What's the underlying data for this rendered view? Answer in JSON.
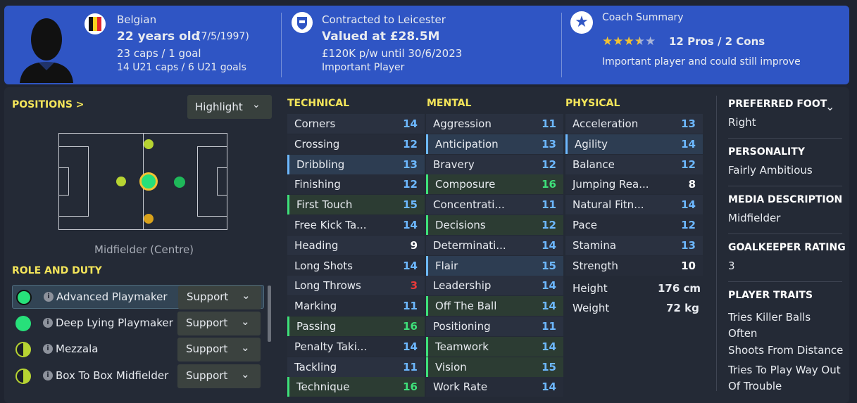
{
  "header": {
    "nationality": "Belgian",
    "age": "22 years old",
    "dob": "(7/5/1997)",
    "caps": "23 caps / 1 goal",
    "u21": "14 U21 caps / 6 U21 goals",
    "contract": "Contracted to Leicester",
    "value": "Valued at £28.5M",
    "wage": "£120K p/w until 30/6/2023",
    "status": "Important Player",
    "coach_title": "Coach Summary",
    "pros_cons": "12 Pros / 2 Cons",
    "coach_text": "Important player and could still improve",
    "star_rating": 3.5
  },
  "positions": {
    "title": "POSITIONS >",
    "highlight": "Highlight",
    "position_label": "Midfielder (Centre)"
  },
  "roles": {
    "title": "ROLE AND DUTY",
    "items": [
      {
        "name": "Advanced Playmaker",
        "duty": "Support"
      },
      {
        "name": "Deep Lying Playmaker",
        "duty": "Support"
      },
      {
        "name": "Mezzala",
        "duty": "Support"
      },
      {
        "name": "Box To Box Midfielder",
        "duty": "Support"
      }
    ]
  },
  "technical": {
    "title": "TECHNICAL",
    "items": [
      {
        "n": "Corners",
        "v": "14"
      },
      {
        "n": "Crossing",
        "v": "12"
      },
      {
        "n": "Dribbling",
        "v": "13"
      },
      {
        "n": "Finishing",
        "v": "12"
      },
      {
        "n": "First Touch",
        "v": "15"
      },
      {
        "n": "Free Kick Ta...",
        "v": "14"
      },
      {
        "n": "Heading",
        "v": "9"
      },
      {
        "n": "Long Shots",
        "v": "14"
      },
      {
        "n": "Long Throws",
        "v": "3"
      },
      {
        "n": "Marking",
        "v": "11"
      },
      {
        "n": "Passing",
        "v": "16"
      },
      {
        "n": "Penalty Taki...",
        "v": "14"
      },
      {
        "n": "Tackling",
        "v": "11"
      },
      {
        "n": "Technique",
        "v": "16"
      }
    ]
  },
  "mental": {
    "title": "MENTAL",
    "items": [
      {
        "n": "Aggression",
        "v": "11"
      },
      {
        "n": "Anticipation",
        "v": "13"
      },
      {
        "n": "Bravery",
        "v": "12"
      },
      {
        "n": "Composure",
        "v": "16"
      },
      {
        "n": "Concentrati...",
        "v": "11"
      },
      {
        "n": "Decisions",
        "v": "12"
      },
      {
        "n": "Determinati...",
        "v": "14"
      },
      {
        "n": "Flair",
        "v": "15"
      },
      {
        "n": "Leadership",
        "v": "14"
      },
      {
        "n": "Off The Ball",
        "v": "14"
      },
      {
        "n": "Positioning",
        "v": "11"
      },
      {
        "n": "Teamwork",
        "v": "14"
      },
      {
        "n": "Vision",
        "v": "15"
      },
      {
        "n": "Work Rate",
        "v": "14"
      }
    ]
  },
  "physical": {
    "title": "PHYSICAL",
    "items": [
      {
        "n": "Acceleration",
        "v": "13"
      },
      {
        "n": "Agility",
        "v": "14"
      },
      {
        "n": "Balance",
        "v": "12"
      },
      {
        "n": "Jumping Rea...",
        "v": "8"
      },
      {
        "n": "Natural Fitn...",
        "v": "14"
      },
      {
        "n": "Pace",
        "v": "12"
      },
      {
        "n": "Stamina",
        "v": "13"
      },
      {
        "n": "Strength",
        "v": "10"
      }
    ],
    "height_label": "Height",
    "height": "176 cm",
    "weight_label": "Weight",
    "weight": "72 kg"
  },
  "profile": {
    "foot_label": "PREFERRED FOOT",
    "foot": "Right",
    "personality_label": "PERSONALITY",
    "personality": "Fairly Ambitious",
    "media_label": "MEDIA DESCRIPTION",
    "media": "Midfielder",
    "gk_label": "GOALKEEPER RATING",
    "gk": "3",
    "traits_label": "PLAYER TRAITS",
    "traits": [
      "Tries Killer Balls Often",
      "Shoots From Distance",
      "Tries To Play Way Out Of Trouble"
    ]
  },
  "colors": {
    "accent": "#f4e55a",
    "header_bg": "#2f55c4",
    "value_green": "#3ee07a",
    "value_blue": "#6db8ff",
    "value_red": "#e83a3a",
    "value_white": "#ffffff"
  }
}
